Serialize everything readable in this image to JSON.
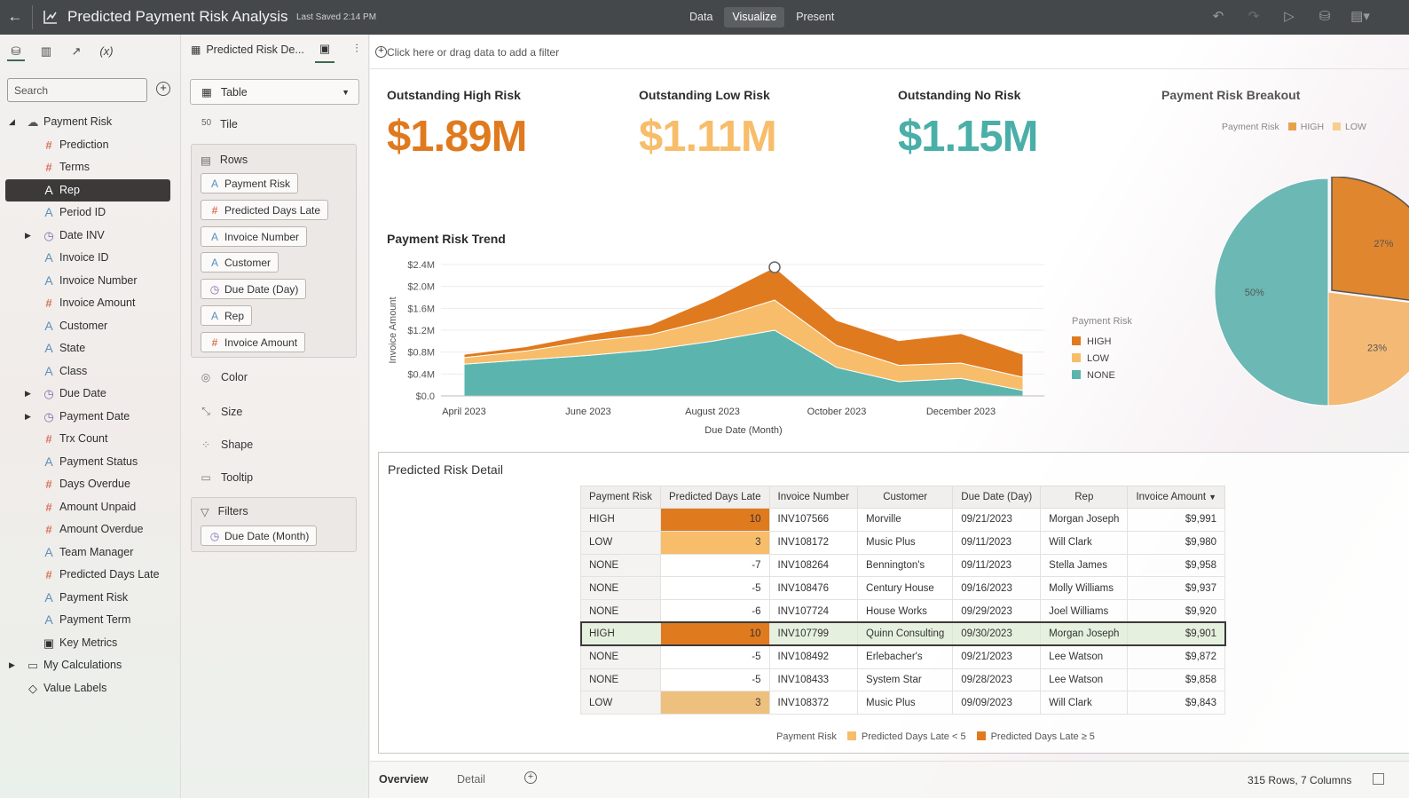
{
  "header": {
    "title": "Predicted Payment Risk Analysis",
    "saved": "Last Saved 2:14 PM",
    "modes": [
      "Data",
      "Visualize",
      "Present"
    ],
    "active_mode": "Visualize"
  },
  "data_panel": {
    "search_placeholder": "Search",
    "tree": [
      {
        "label": "Payment Risk",
        "icon": "dataset-icon",
        "level": 0,
        "caret": "expanded"
      },
      {
        "label": "Prediction",
        "icon": "hash",
        "level": 1
      },
      {
        "label": "Terms",
        "icon": "hash",
        "level": 1
      },
      {
        "label": "Rep",
        "icon": "A",
        "level": 1,
        "selected": true
      },
      {
        "label": "Period ID",
        "icon": "A",
        "level": 1
      },
      {
        "label": "Date INV",
        "icon": "clock",
        "level": 1,
        "caret": "collapsed"
      },
      {
        "label": "Invoice ID",
        "icon": "A",
        "level": 1
      },
      {
        "label": "Invoice Number",
        "icon": "A",
        "level": 1
      },
      {
        "label": "Invoice Amount",
        "icon": "hash",
        "level": 1
      },
      {
        "label": "Customer",
        "icon": "A",
        "level": 1
      },
      {
        "label": "State",
        "icon": "A",
        "level": 1
      },
      {
        "label": "Class",
        "icon": "A",
        "level": 1
      },
      {
        "label": "Due Date",
        "icon": "clock",
        "level": 1,
        "caret": "collapsed"
      },
      {
        "label": "Payment Date",
        "icon": "clock",
        "level": 1,
        "caret": "collapsed"
      },
      {
        "label": "Trx Count",
        "icon": "hash",
        "level": 1
      },
      {
        "label": "Payment Status",
        "icon": "A",
        "level": 1
      },
      {
        "label": "Days Overdue",
        "icon": "hash",
        "level": 1
      },
      {
        "label": "Amount Unpaid",
        "icon": "hash",
        "level": 1
      },
      {
        "label": "Amount Overdue",
        "icon": "hash",
        "level": 1
      },
      {
        "label": "Team Manager",
        "icon": "A",
        "level": 1
      },
      {
        "label": "Predicted Days Late",
        "icon": "hash",
        "level": 1
      },
      {
        "label": "Payment Risk",
        "icon": "A",
        "level": 1
      },
      {
        "label": "Payment Term",
        "icon": "A",
        "level": 1
      },
      {
        "label": "Key Metrics",
        "icon": "metrics-icon",
        "level": 1
      },
      {
        "label": "My Calculations",
        "icon": "folder",
        "level": 0,
        "caret": "collapsed"
      },
      {
        "label": "Value Labels",
        "icon": "tag",
        "level": 0
      }
    ]
  },
  "grammar_panel": {
    "viz_name": "Predicted Risk De...",
    "viz_type": "Table",
    "tile_label": "Tile",
    "rows_label": "Rows",
    "rows": [
      {
        "label": "Payment Risk",
        "icon": "A"
      },
      {
        "label": "Predicted Days Late",
        "icon": "hash"
      },
      {
        "label": "Invoice Number",
        "icon": "A"
      },
      {
        "label": "Customer",
        "icon": "A"
      },
      {
        "label": "Due Date (Day)",
        "icon": "clock"
      },
      {
        "label": "Rep",
        "icon": "A"
      },
      {
        "label": "Invoice Amount",
        "icon": "hash"
      }
    ],
    "props": [
      "Color",
      "Size",
      "Shape",
      "Tooltip"
    ],
    "filters_label": "Filters",
    "filters": [
      {
        "label": "Due Date (Month)",
        "icon": "clock"
      }
    ]
  },
  "filter_bar": {
    "placeholder": "Click here or drag data to add a filter"
  },
  "kpis": [
    {
      "title": "Outstanding High Risk",
      "value": "$1.89M",
      "color": "#e07a1f"
    },
    {
      "title": "Outstanding Low Risk",
      "value": "$1.11M",
      "color": "#f7bd6a"
    },
    {
      "title": "Outstanding No Risk",
      "value": "$1.15M",
      "color": "#4aafa8"
    }
  ],
  "trend": {
    "title": "Payment Risk Trend",
    "chart_data": {
      "type": "area",
      "x": [
        "April 2023",
        "May 2023",
        "June 2023",
        "July 2023",
        "August 2023",
        "September 2023",
        "October 2023",
        "November 2023",
        "December 2023",
        "January 2024"
      ],
      "x_tick_labels": [
        "April 2023",
        "June 2023",
        "August 2023",
        "October 2023",
        "December 2023"
      ],
      "xlabel": "Due Date (Month)",
      "ylabel": "Invoice Amount",
      "y_ticks": [
        "$2.4M",
        "$2.0M",
        "$1.6M",
        "$1.2M",
        "$0.8M",
        "$0.4M",
        "$0.0"
      ],
      "ylim": [
        0,
        2.4
      ],
      "stacked": true,
      "series": [
        {
          "name": "NONE",
          "color": "#5bb5ae",
          "values": [
            0.58,
            0.66,
            0.74,
            0.84,
            1.0,
            1.2,
            0.52,
            0.26,
            0.32,
            0.1
          ]
        },
        {
          "name": "LOW",
          "color": "#f7bd6a",
          "values": [
            0.12,
            0.16,
            0.26,
            0.28,
            0.4,
            0.55,
            0.4,
            0.3,
            0.28,
            0.24
          ]
        },
        {
          "name": "HIGH",
          "color": "#e07a1f",
          "values": [
            0.06,
            0.08,
            0.12,
            0.18,
            0.38,
            0.6,
            0.46,
            0.45,
            0.54,
            0.42
          ]
        }
      ],
      "legend_title": "Payment Risk",
      "legend_position": "right"
    }
  },
  "breakout": {
    "title": "Payment Risk Breakout",
    "legend_title": "Payment Risk",
    "chart_data": {
      "type": "pie",
      "categories": [
        "HIGH",
        "LOW",
        "NONE"
      ],
      "values": [
        27,
        23,
        50
      ],
      "labels": [
        "27%",
        "23%",
        "50%"
      ],
      "colors": [
        "#e0862e",
        "#f4ba75",
        "#6bb8b4"
      ]
    }
  },
  "detail": {
    "title": "Predicted Risk Detail",
    "columns": [
      "Payment Risk",
      "Predicted Days Late",
      "Invoice Number",
      "Customer",
      "Due Date (Day)",
      "Rep",
      "Invoice Amount"
    ],
    "sort_indicator": "▼",
    "rows": [
      [
        "HIGH",
        "10",
        "INV107566",
        "Morville",
        "09/21/2023",
        "Morgan Joseph",
        "$9,991"
      ],
      [
        "LOW",
        "3",
        "INV108172",
        "Music Plus",
        "09/11/2023",
        "Will Clark",
        "$9,980"
      ],
      [
        "NONE",
        "-7",
        "INV108264",
        "Bennington's",
        "09/11/2023",
        "Stella James",
        "$9,958"
      ],
      [
        "NONE",
        "-5",
        "INV108476",
        "Century House",
        "09/16/2023",
        "Molly Williams",
        "$9,937"
      ],
      [
        "NONE",
        "-6",
        "INV107724",
        "House Works",
        "09/29/2023",
        "Joel Williams",
        "$9,920"
      ],
      [
        "HIGH",
        "10",
        "INV107799",
        "Quinn Consulting",
        "09/30/2023",
        "Morgan Joseph",
        "$9,901"
      ],
      [
        "NONE",
        "-5",
        "INV108492",
        "Erlebacher's",
        "09/21/2023",
        "Lee Watson",
        "$9,872"
      ],
      [
        "NONE",
        "-5",
        "INV108433",
        "System Star",
        "09/28/2023",
        "Lee Watson",
        "$9,858"
      ],
      [
        "LOW",
        "3",
        "INV108372",
        "Music Plus",
        "09/09/2023",
        "Will Clark",
        "$9,843"
      ]
    ],
    "highlight_row": 5,
    "cell_colors": {
      "HIGH": "#e07a1f",
      "LOW": "#f7bd6a"
    },
    "legend_title": "Payment Risk",
    "legend": [
      {
        "label": "Predicted Days Late < 5",
        "color": "#f7bd6a"
      },
      {
        "label": "Predicted Days Late ≥ 5",
        "color": "#e07a1f"
      }
    ]
  },
  "bottom": {
    "tabs": [
      "Overview",
      "Detail"
    ],
    "status": "315 Rows, 7 Columns"
  }
}
